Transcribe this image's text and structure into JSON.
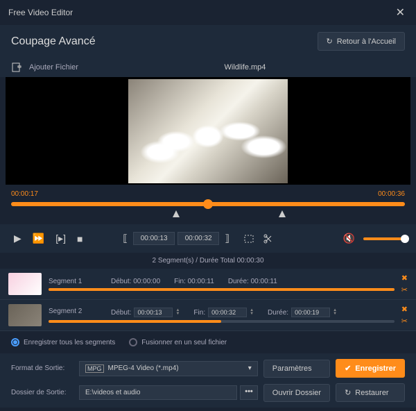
{
  "titlebar": {
    "title": "Free Video Editor"
  },
  "header": {
    "title": "Coupage Avancé",
    "back_label": "Retour à l'Accueil"
  },
  "file": {
    "add_label": "Ajouter Fichier",
    "name": "Wildlife.mp4"
  },
  "timeline": {
    "start": "00:00:17",
    "end": "00:00:36"
  },
  "trim": {
    "in": "00:00:13",
    "out": "00:00:32"
  },
  "segments_summary": "2 Segment(s) / Durée Total 00:00:30",
  "segments": [
    {
      "name": "Segment 1",
      "debut_label": "Début:",
      "debut": "00:00:00",
      "fin_label": "Fin:",
      "fin": "00:00:11",
      "duree_label": "Durée:",
      "duree": "00:00:11",
      "static": true,
      "fill": 100
    },
    {
      "name": "Segment 2",
      "debut_label": "Début:",
      "debut": "00:00:13",
      "fin_label": "Fin:",
      "fin": "00:00:32",
      "duree_label": "Durée:",
      "duree": "00:00:19",
      "static": false,
      "fill": 50
    }
  ],
  "options": {
    "save_all": "Enregistrer tous les segments",
    "merge": "Fusionner en un seul fichier"
  },
  "output": {
    "format_label": "Format de Sortie:",
    "format_value": "MPEG-4 Video (*.mp4)",
    "folder_label": "Dossier de Sortie:",
    "folder_value": "E:\\videos et audio",
    "params": "Paramètres",
    "open": "Ouvrir Dossier",
    "save": "Enregistrer",
    "restore": "Restaurer"
  }
}
